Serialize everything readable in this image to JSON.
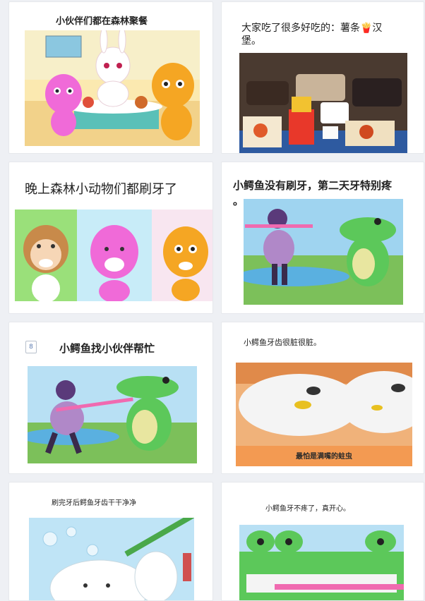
{
  "cards": [
    {
      "caption": "小伙伴们都在森林聚餐"
    },
    {
      "caption_line1": "大家吃了很多好吃的：薯条🍟汉",
      "caption_line2": "堡。"
    },
    {
      "caption": "晚上森林小动物们都刷牙了"
    },
    {
      "caption_line1": "小鳄鱼没有刷牙，第二天牙特别疼",
      "caption_line2": "。"
    },
    {
      "caption": "小鳄鱼找小伙伴帮忙",
      "checkbox_glyph": "8"
    },
    {
      "caption": "小鳄鱼牙齿很脏很脏。",
      "subtitle": "最怕是满嘴的蛀虫"
    },
    {
      "caption": "刷完牙后鳄鱼牙齿干干净净"
    },
    {
      "caption": "小鳄鱼牙不疼了，真开心。"
    }
  ],
  "colors": {
    "background": "#eef0f4",
    "card": "#ffffff",
    "card_border": "#e6e8ec"
  }
}
